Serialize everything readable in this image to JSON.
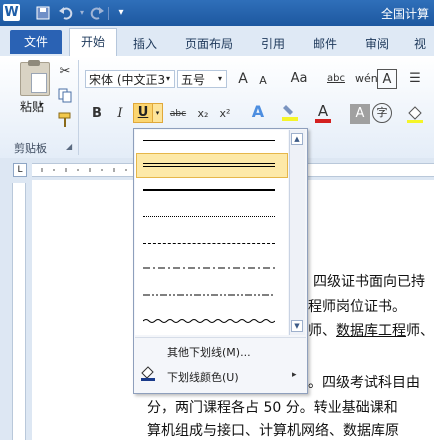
{
  "titlebar": {
    "logo": "W",
    "title": "全国计算",
    "qat": [
      "save-icon",
      "undo-icon",
      "redo-icon",
      "customize-icon"
    ]
  },
  "tabs": {
    "file": "文件",
    "home": "开始",
    "items": [
      "插入",
      "页面布局",
      "引用",
      "邮件",
      "审阅",
      "视"
    ]
  },
  "ribbon": {
    "paste": "粘贴",
    "clipboard_group": "剪贴板",
    "font_name": "宋体 (中文正3",
    "font_size": "五号",
    "grow_font": "A",
    "shrink_font": "A",
    "change_case": "Aa",
    "bold": "B",
    "italic": "I",
    "underline": "U",
    "strikethrough": "abc",
    "subscript": "x₂",
    "superscript": "x²",
    "text_effect": "A",
    "font_color": "A",
    "char_shading": "A",
    "enclose_char": "字",
    "clear_format_1": "A",
    "clear_format_2": "A",
    "accent_color": "#fbd570",
    "font_color_value": "#d42020",
    "highlight_color": "#f5f529"
  },
  "underline_menu": {
    "styles": [
      "single",
      "double",
      "thick",
      "dotted",
      "dashed",
      "dash-dot",
      "dash-dot-dot",
      "wave"
    ],
    "selected": "double",
    "more": "其他下划线(M)...",
    "color": "下划线颜色(U)"
  },
  "document": {
    "line1": "四级证书面向已持",
    "line2": "程师岗位证书。",
    "line3_pre": "师、",
    "line3_underlined": "数据库工程",
    "line3_post": "师、",
    "line4": "。四级考试科目由",
    "line5": "分，两门课程各占 50 分。转业基础课和",
    "line6": "算机组成与接口、计算机网络、数据库原"
  }
}
